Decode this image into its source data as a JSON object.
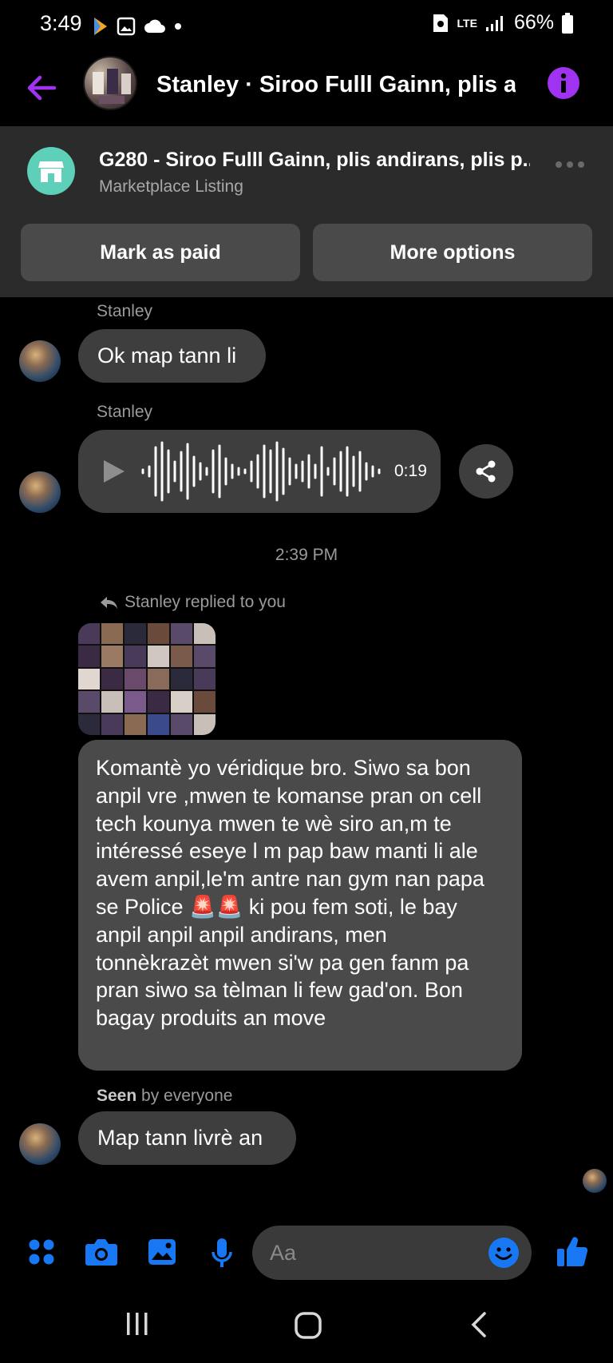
{
  "status_bar": {
    "time": "3:49",
    "network": "LTE",
    "battery": "66%"
  },
  "header": {
    "title": "Stanley · Siroo Fulll Gainn, plis a...",
    "accent_color": "#a032f2"
  },
  "listing": {
    "title": "G280 - Siroo Fulll Gainn, plis andirans, plis p...",
    "subtitle": "Marketplace Listing",
    "mark_paid_label": "Mark as paid",
    "more_options_label": "More options"
  },
  "messages": {
    "m1": {
      "sender": "Stanley",
      "text": "Ok map tann li"
    },
    "m2": {
      "sender": "Stanley",
      "duration": "0:19"
    },
    "timestamp": "2:39 PM",
    "m3": {
      "reply_label": "Stanley replied to you",
      "text": "Komantè yo véridique bro. Siwo sa bon anpil vre ,mwen te komanse pran on cell tech kounya mwen te wè siro an,m te intéressé eseye l m pap baw manti li ale avem anpil,le'm antre nan gym nan papa se Police 🚨🚨 ki pou fem soti, le bay anpil anpil anpil andirans, men tonnèkrazèt mwen si'w pa gen fanm pa pran siwo sa tèlman li few gad'on. Bon bagay produits an move"
    },
    "seen": {
      "bold": "Seen",
      "rest": " by everyone"
    },
    "m4": {
      "text": "Map tann livrè an"
    }
  },
  "composer": {
    "placeholder": "Aa",
    "icon_color": "#1877f2"
  }
}
